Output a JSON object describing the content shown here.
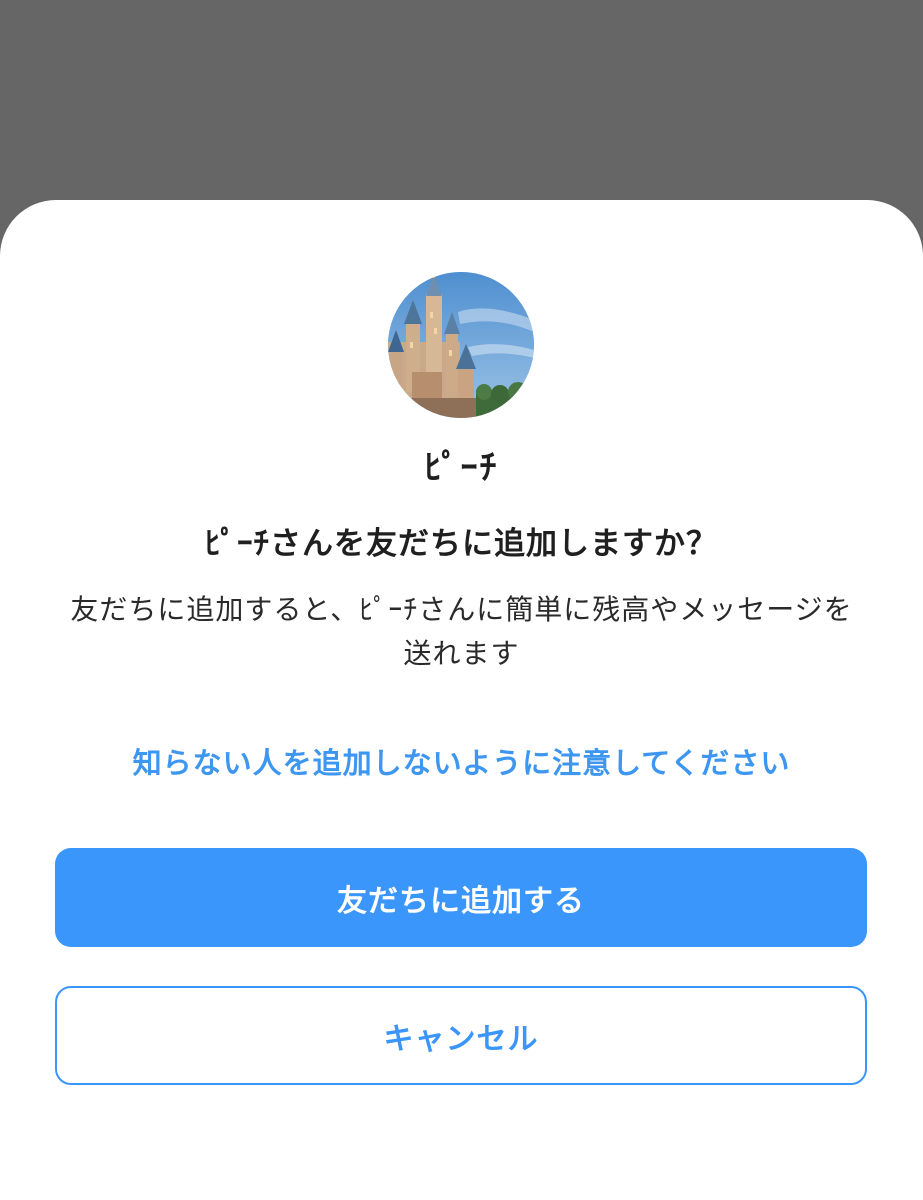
{
  "dialog": {
    "display_name": "ﾋﾟｰﾁ",
    "question": "ﾋﾟｰﾁさんを友だちに追加しますか？",
    "description": "友だちに追加すると、ﾋﾟｰﾁさんに簡単に残高やメッセージを送れます",
    "caution_link": "知らない人を追加しないように注意してください",
    "add_friend_button": "友だちに追加する",
    "cancel_button": "キャンセル"
  },
  "colors": {
    "accent": "#3b96fb",
    "link": "#3d96ef",
    "overlay": "#666666",
    "text": "#1f1f1f"
  },
  "icons": {
    "avatar": "castle-photo-avatar"
  }
}
